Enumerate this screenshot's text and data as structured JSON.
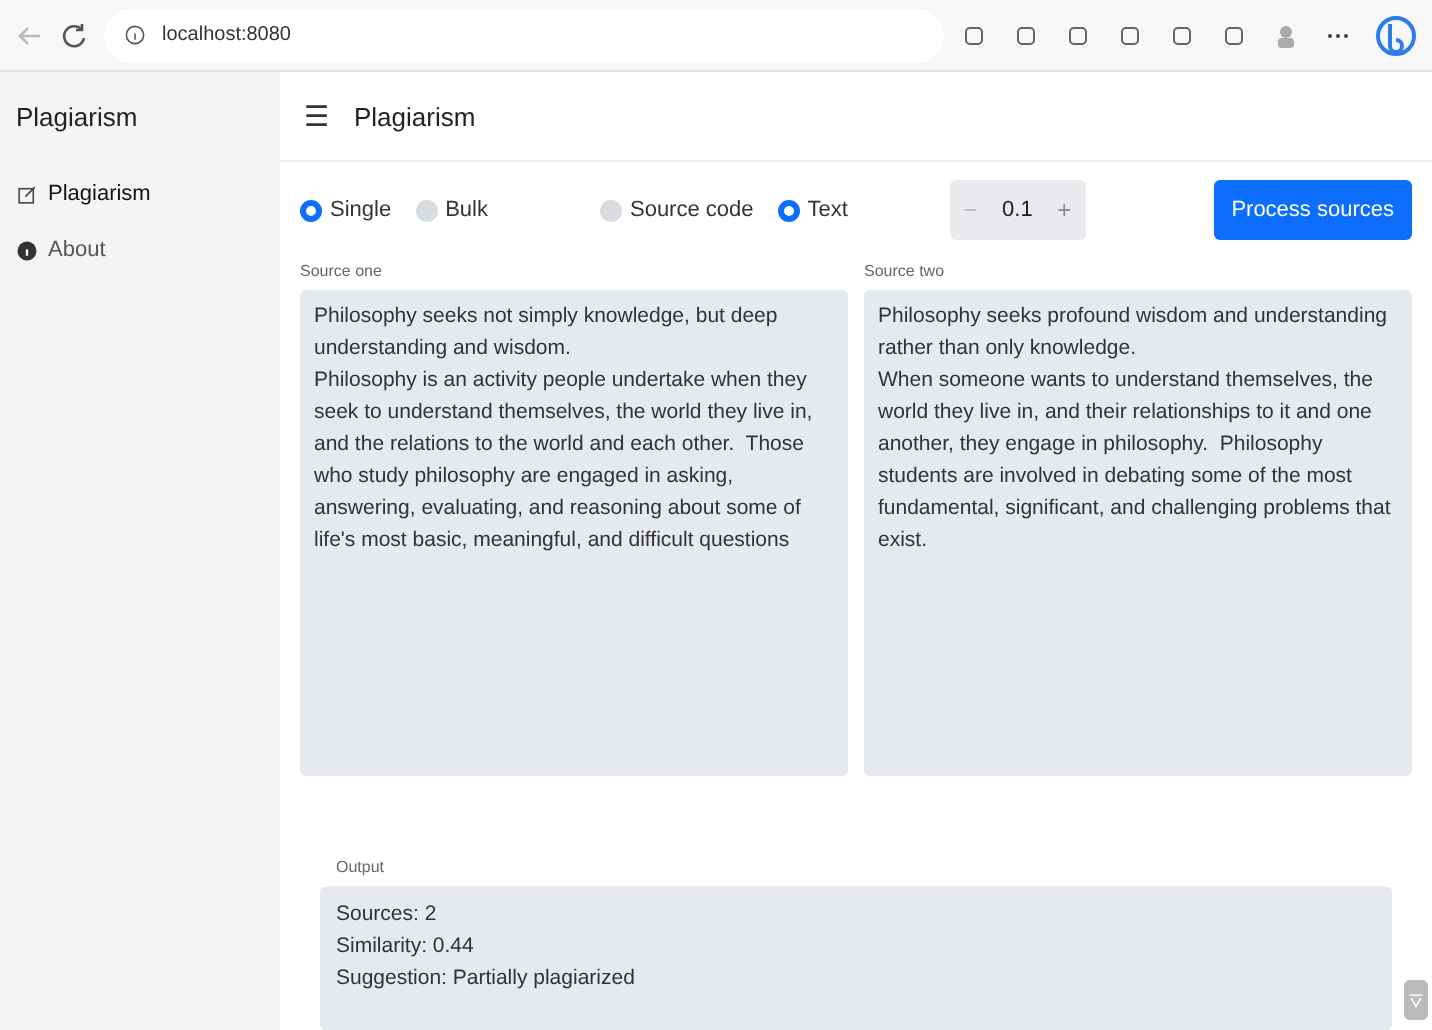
{
  "browser": {
    "url": "localhost:8080"
  },
  "sidebar": {
    "title": "Plagiarism",
    "items": [
      {
        "label": "Plagiarism",
        "kind": "edit",
        "selected": true
      },
      {
        "label": "About",
        "kind": "info",
        "selected": false
      }
    ]
  },
  "header": {
    "menu_icon": "☰",
    "title": "Plagiarism"
  },
  "mode_options": [
    {
      "label": "Single",
      "selected": true
    },
    {
      "label": "Bulk",
      "selected": false
    }
  ],
  "type_options": [
    {
      "label": "Source code",
      "selected": false
    },
    {
      "label": "Text",
      "selected": true
    }
  ],
  "threshold": {
    "minus": "−",
    "value": "0.1",
    "plus": "+"
  },
  "process_button": "Process sources",
  "sources": [
    {
      "label": "Source one",
      "value": "Philosophy seeks not simply knowledge, but deep understanding and wisdom.\nPhilosophy is an activity people undertake when they seek to understand themselves, the world they live in, and the relations to the world and each other.  Those who study philosophy are engaged in asking, answering, evaluating, and reasoning about some of life's most basic, meaningful, and difficult questions"
    },
    {
      "label": "Source two",
      "value": "Philosophy seeks profound wisdom and understanding rather than only knowledge.\nWhen someone wants to understand themselves, the world they live in, and their relationships to it and one another, they engage in philosophy.  Philosophy students are involved in debating some of the most fundamental, significant, and challenging problems that exist."
    }
  ],
  "output": {
    "label": "Output",
    "lines": [
      "Sources: 2",
      "Similarity: 0.44",
      "Suggestion: Partially plagiarized"
    ]
  }
}
